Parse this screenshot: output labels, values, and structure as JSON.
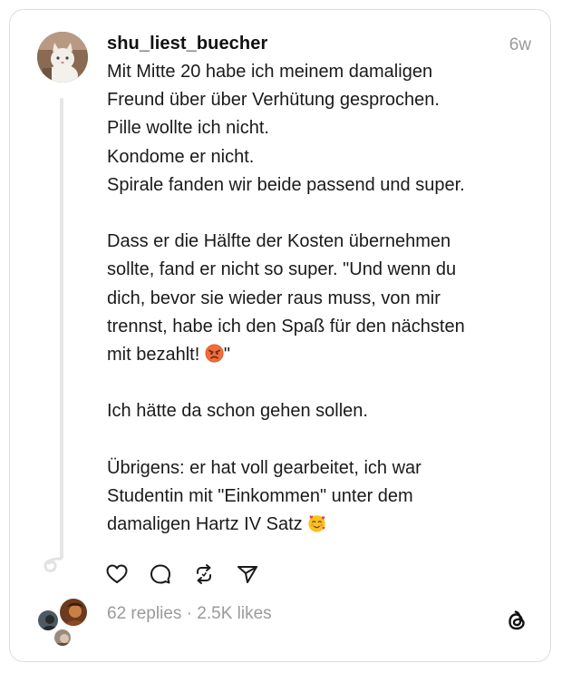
{
  "post": {
    "username": "shu_liest_buecher",
    "time": "6w",
    "lines": [
      "Mit Mitte 20 habe ich meinem damaligen",
      "Freund über über Verhütung gesprochen.",
      "Pille wollte ich nicht.",
      "Kondome er nicht.",
      "Spirale fanden wir beide passend und super.",
      "",
      "Dass er die Hälfte der Kosten übernehmen",
      "sollte, fand er nicht so super. \"Und wenn du",
      "dich, bevor sie wieder raus muss, von mir",
      "trennst, habe ich den Spaß für den nächsten",
      "mit bezahlt!",
      "",
      "Ich hätte da schon gehen sollen.",
      "",
      "Übrigens: er hat voll gearbeitet, ich war",
      "Studentin mit \"Einkommen\" unter dem",
      "damaligen Hartz IV Satz"
    ],
    "quote_close": "\"",
    "emoji_angry": "angry-face-emoji",
    "emoji_love": "smiling-face-with-hearts-emoji"
  },
  "actions": {
    "like": "heart-icon",
    "reply": "comment-icon",
    "repost": "repost-icon",
    "share": "send-icon"
  },
  "stats": {
    "replies": "62 replies",
    "separator": " · ",
    "likes": "2.5K likes"
  },
  "colors": {
    "text": "#1a1a1a",
    "muted": "#9a9a9a",
    "border": "#dcdcdc"
  }
}
